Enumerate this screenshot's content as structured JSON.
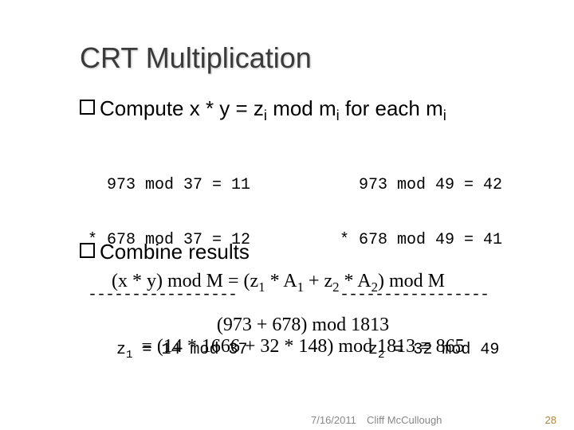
{
  "title": "CRT Multiplication",
  "bullet1_pre": "Compute x * y = z",
  "bullet1_mid": " mod m",
  "bullet1_mid2": " for each m",
  "sub_i": "i",
  "col_left": {
    "l1": "  973 mod 37 = 11",
    "l2": "* 678 mod 37 = 12",
    "dash": "-----------------",
    "res_pre": "   z",
    "res_post": " = 14 mod 37",
    "res_sub": "1"
  },
  "col_right": {
    "l1": "  973 mod 49 = 42",
    "l2": "* 678 mod 49 = 41",
    "dash": "-----------------",
    "res_pre": "   z",
    "res_post": " = 32 mod 49",
    "res_sub": "2"
  },
  "bullet2": "Combine results",
  "formula": {
    "pre": "(x * y) mod M = (z",
    "s1": "1",
    "mid1": " * A",
    "mid2": " + z",
    "s2": "2",
    "mid3": " * A",
    "end": ") mod M"
  },
  "calc_l1": "(973 + 678) mod 1813",
  "calc_l2": "= (14 * 1666 + 32 * 148) mod 1813 ≡ 865",
  "footer": {
    "date": "7/16/2011",
    "author": "Cliff McCullough",
    "page": "28"
  }
}
